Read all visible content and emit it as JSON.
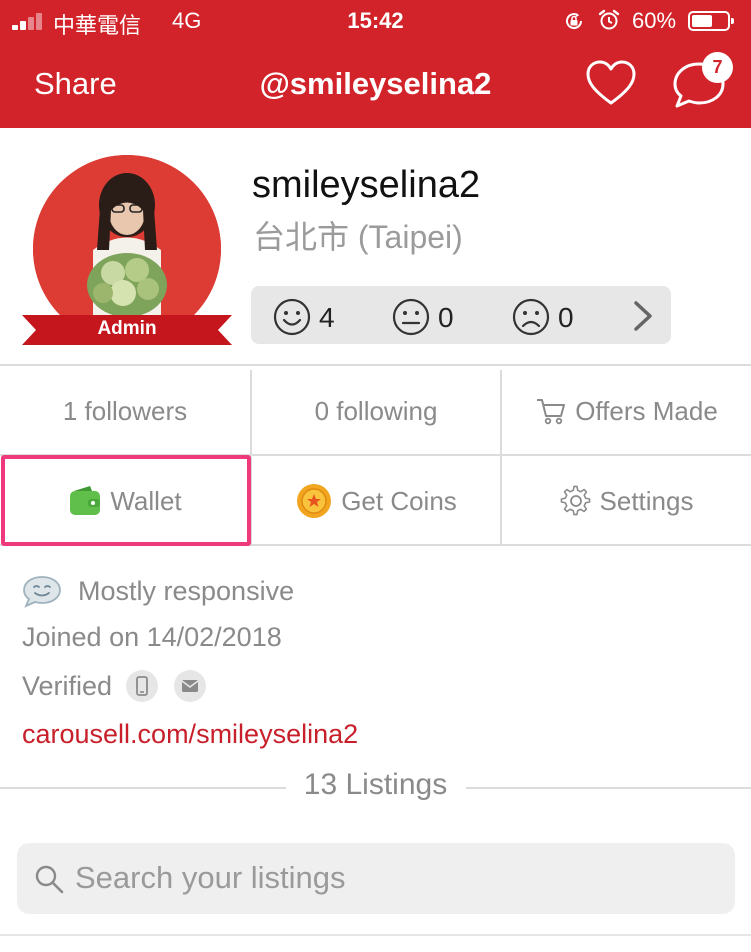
{
  "status_bar": {
    "carrier": "中華電信",
    "network": "4G",
    "time": "15:42",
    "battery": "60%",
    "battery_level": 0.6,
    "icons": [
      "signal-icon",
      "rotation-lock-icon",
      "alarm-icon",
      "battery-icon"
    ]
  },
  "navbar": {
    "share_label": "Share",
    "title": "@smileyselina2",
    "message_badge": "7",
    "icons": [
      "heart-icon",
      "chat-icon"
    ]
  },
  "profile": {
    "username": "smileyselina2",
    "location": "台北市 (Taipei)",
    "role_badge": "Admin",
    "reviews": {
      "positive": "4",
      "neutral": "0",
      "negative": "0"
    }
  },
  "stats": {
    "followers": "1 followers",
    "following": "0 following",
    "offers": "Offers Made"
  },
  "actions": {
    "wallet": "Wallet",
    "get_coins": "Get Coins",
    "settings": "Settings"
  },
  "info": {
    "responsiveness": "Mostly responsive",
    "joined": "Joined on 14/02/2018",
    "verified": "Verified",
    "profile_link": "carousell.com/smileyselina2"
  },
  "listings": {
    "count_label": "13 Listings",
    "search_placeholder": "Search your listings"
  },
  "colors": {
    "brand_red": "#d2232a",
    "highlight_pink": "#f0397c",
    "link_red": "#c8202a",
    "wallet_green": "#5fbf4a",
    "coin_gold": "#f2a51e"
  }
}
